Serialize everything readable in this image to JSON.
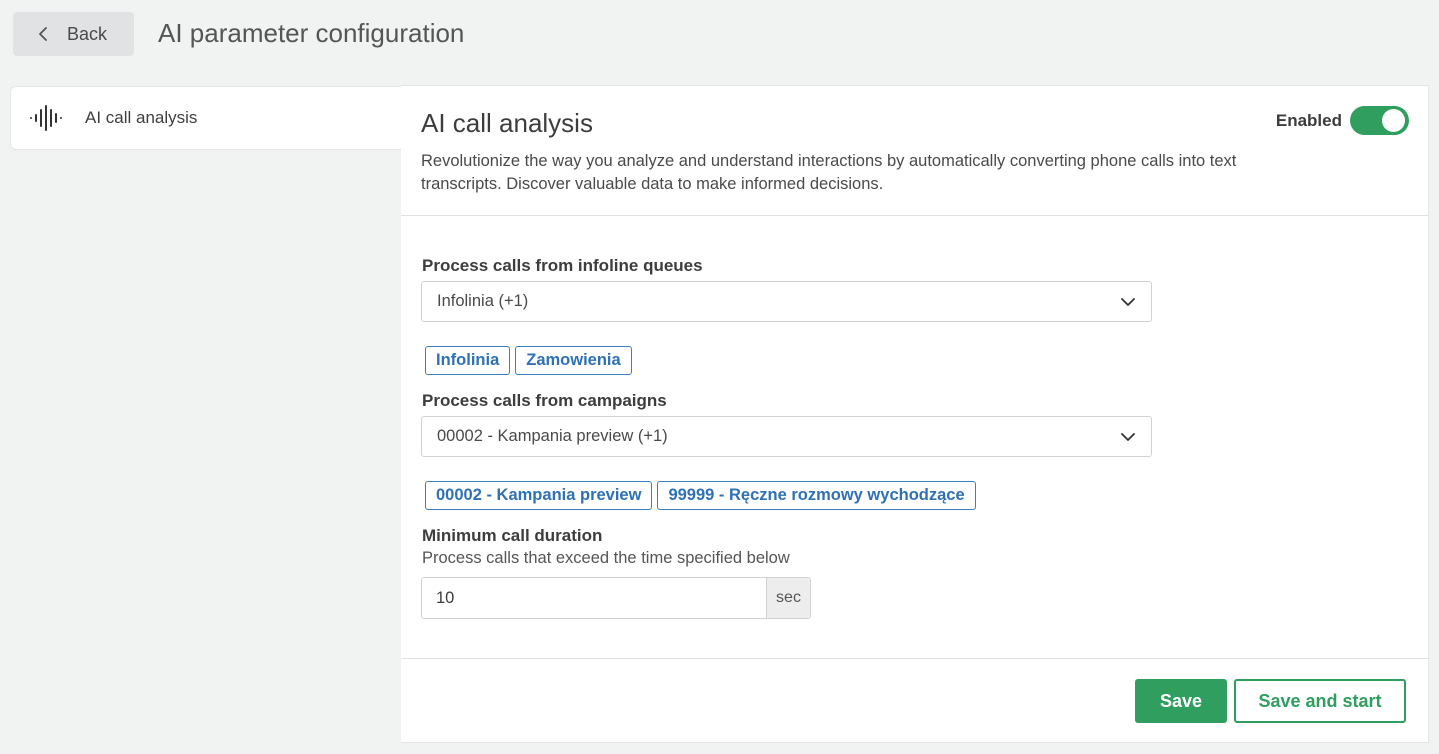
{
  "header": {
    "back_label": "Back",
    "back_icon": "chevron-left-icon",
    "title": "AI parameter configuration"
  },
  "sidebar": {
    "items": [
      {
        "label": "AI call analysis",
        "icon": "audio-waveform-icon",
        "active": true
      }
    ]
  },
  "section": {
    "title": "AI call analysis",
    "description": "Revolutionize the way you analyze and understand interactions by automatically converting phone calls into text transcripts. Discover valuable data to make informed decisions.",
    "toggle_label": "Enabled",
    "toggle_on": true
  },
  "queues": {
    "label": "Process calls from infoline queues",
    "selected_value": "Infolinia  (+1)",
    "chips": [
      "Infolinia",
      "Zamowienia"
    ]
  },
  "campaigns": {
    "label": "Process calls from campaigns",
    "selected_value": "00002 - Kampania preview  (+1)",
    "chips": [
      "00002 - Kampania preview",
      "99999 - Ręczne rozmowy wychodzące"
    ]
  },
  "duration": {
    "label": "Minimum call duration",
    "sublabel": "Process calls that exceed the time specified below",
    "value": "10",
    "unit": "sec"
  },
  "footer": {
    "save_label": "Save",
    "save_start_label": "Save and start"
  },
  "colors": {
    "accent_green": "#2f9e5f",
    "chip_blue": "#2f71b5",
    "background": "#f1f2f2"
  }
}
